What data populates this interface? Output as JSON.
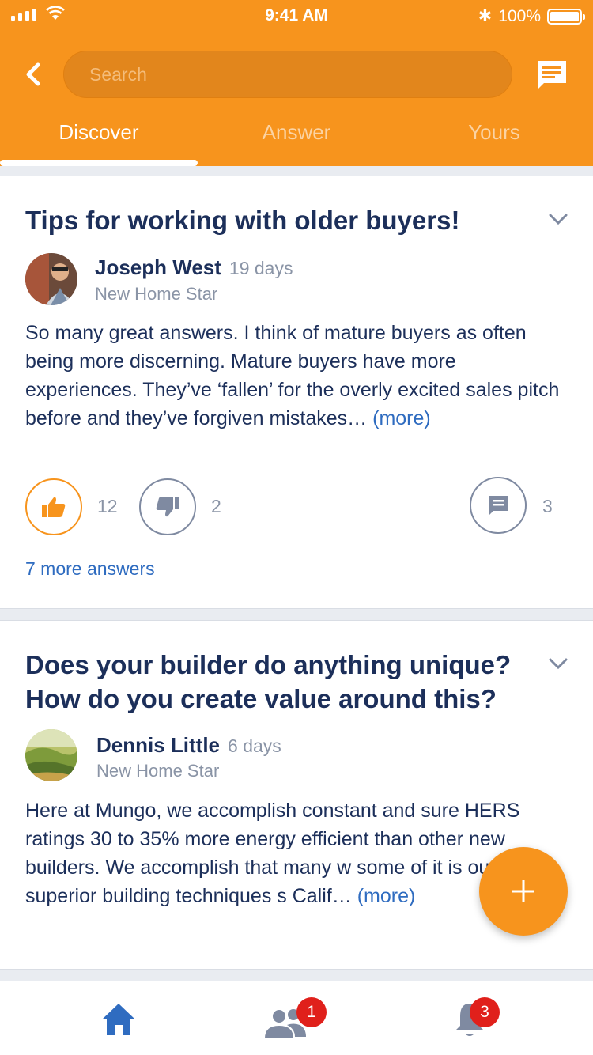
{
  "status_bar": {
    "time": "9:41 AM",
    "battery": "100%"
  },
  "header": {
    "search_placeholder": "Search",
    "tabs": [
      {
        "label": "Discover",
        "active": true
      },
      {
        "label": "Answer",
        "active": false
      },
      {
        "label": "Yours",
        "active": false
      }
    ]
  },
  "posts": [
    {
      "title": "Tips for working with older buyers!",
      "author": "Joseph West",
      "age": "19 days",
      "role": "New Home Star",
      "body": "So many great answers.  I think of mature buyers as often being more discerning.   Mature buyers have more experiences.  They’ve ‘fallen’ for the overly excited sales pitch before and they’ve forgiven mistakes…",
      "more_label": "(more)",
      "upvotes": "12",
      "downvotes": "2",
      "comments": "3",
      "answers_link": "7 more answers"
    },
    {
      "title": "Does your builder do anything unique? How do you create value around this?",
      "author": "Dennis Little",
      "age": "6 days",
      "role": "New Home Star",
      "body": "Here at Mungo, we accomplish constant and sure HERS ratings 30 to 35% more energy efficient than other new builders. We accomplish that many w some of it is our superior building techniques s Calif…",
      "more_label": "(more)"
    }
  ],
  "bottom_nav": {
    "people_badge": "1",
    "notifications_badge": "3"
  },
  "colors": {
    "accent": "#f7941d",
    "primary_text": "#1c2f5a",
    "link": "#2f6cc0",
    "badge": "#e0201b"
  }
}
